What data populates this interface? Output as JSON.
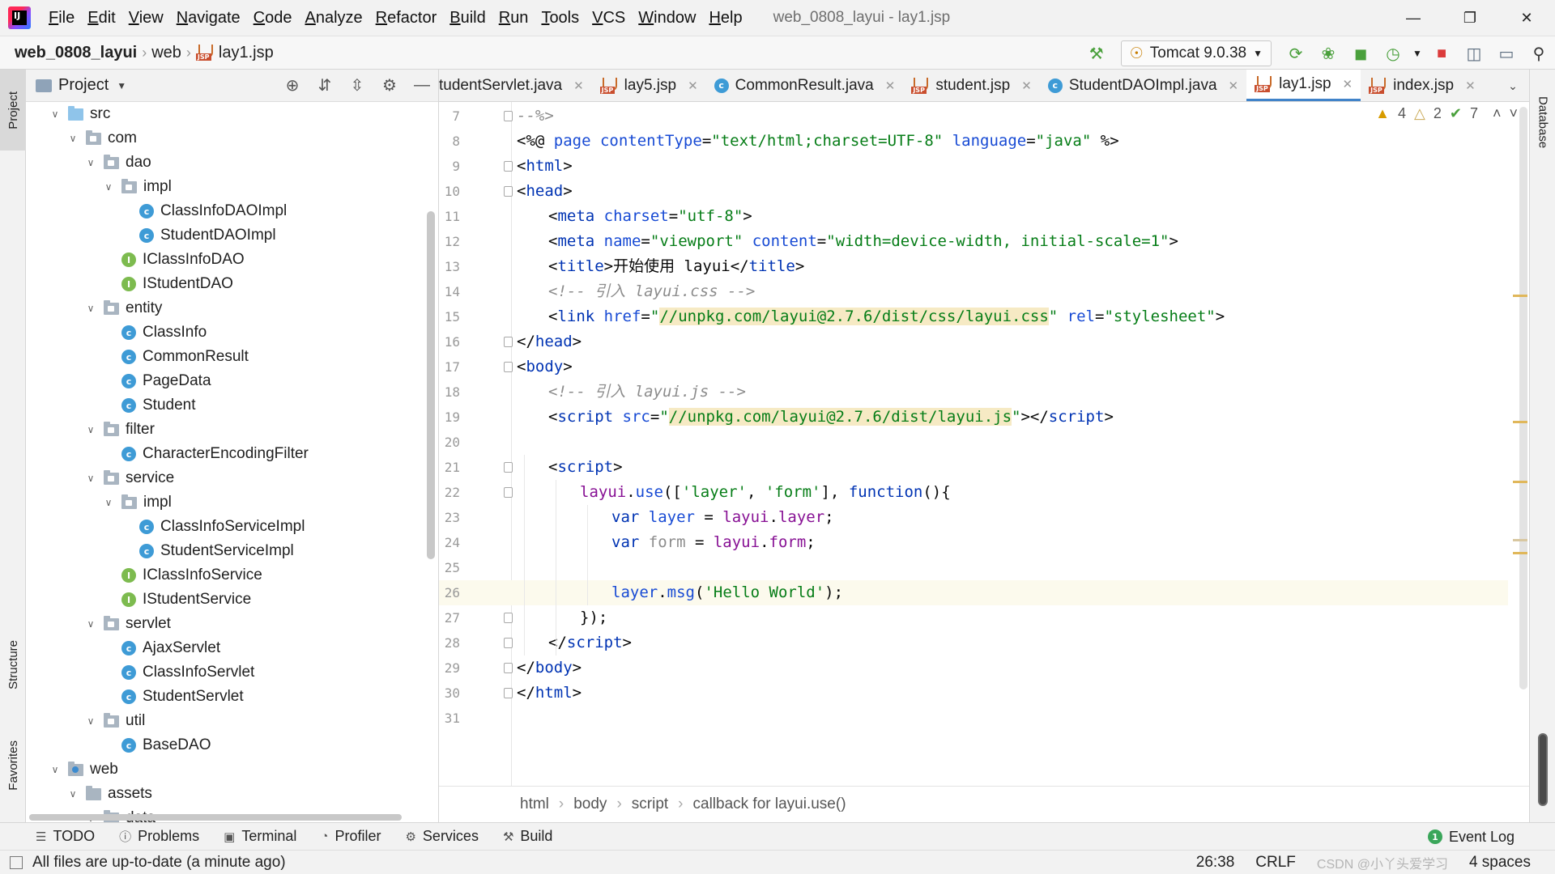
{
  "menu": {
    "items": [
      "File",
      "Edit",
      "View",
      "Navigate",
      "Code",
      "Analyze",
      "Refactor",
      "Build",
      "Run",
      "Tools",
      "VCS",
      "Window",
      "Help"
    ],
    "window_title": "web_0808_layui - lay1.jsp"
  },
  "nav": {
    "project": "web_0808_layui",
    "folder": "web",
    "file": "lay1.jsp",
    "run_config": "Tomcat 9.0.38"
  },
  "side_tabs": {
    "project": "Project",
    "structure": "Structure",
    "favorites": "Favorites",
    "database": "Database"
  },
  "project_panel": {
    "title": "Project"
  },
  "tree": [
    {
      "label": "src",
      "level": 1,
      "kind": "src-folder",
      "expanded": true
    },
    {
      "label": "com",
      "level": 2,
      "kind": "package",
      "expanded": true
    },
    {
      "label": "dao",
      "level": 3,
      "kind": "package",
      "expanded": true
    },
    {
      "label": "impl",
      "level": 4,
      "kind": "package",
      "expanded": true
    },
    {
      "label": "ClassInfoDAOImpl",
      "level": 5,
      "kind": "class"
    },
    {
      "label": "StudentDAOImpl",
      "level": 5,
      "kind": "class"
    },
    {
      "label": "IClassInfoDAO",
      "level": 4,
      "kind": "interface"
    },
    {
      "label": "IStudentDAO",
      "level": 4,
      "kind": "interface"
    },
    {
      "label": "entity",
      "level": 3,
      "kind": "package",
      "expanded": true
    },
    {
      "label": "ClassInfo",
      "level": 4,
      "kind": "class"
    },
    {
      "label": "CommonResult",
      "level": 4,
      "kind": "class"
    },
    {
      "label": "PageData",
      "level": 4,
      "kind": "class"
    },
    {
      "label": "Student",
      "level": 4,
      "kind": "class"
    },
    {
      "label": "filter",
      "level": 3,
      "kind": "package",
      "expanded": true
    },
    {
      "label": "CharacterEncodingFilter",
      "level": 4,
      "kind": "class"
    },
    {
      "label": "service",
      "level": 3,
      "kind": "package",
      "expanded": true
    },
    {
      "label": "impl",
      "level": 4,
      "kind": "package",
      "expanded": true
    },
    {
      "label": "ClassInfoServiceImpl",
      "level": 5,
      "kind": "class"
    },
    {
      "label": "StudentServiceImpl",
      "level": 5,
      "kind": "class"
    },
    {
      "label": "IClassInfoService",
      "level": 4,
      "kind": "interface"
    },
    {
      "label": "IStudentService",
      "level": 4,
      "kind": "interface"
    },
    {
      "label": "servlet",
      "level": 3,
      "kind": "package",
      "expanded": true
    },
    {
      "label": "AjaxServlet",
      "level": 4,
      "kind": "class"
    },
    {
      "label": "ClassInfoServlet",
      "level": 4,
      "kind": "class"
    },
    {
      "label": "StudentServlet",
      "level": 4,
      "kind": "class"
    },
    {
      "label": "util",
      "level": 3,
      "kind": "package",
      "expanded": true
    },
    {
      "label": "BaseDAO",
      "level": 4,
      "kind": "class"
    },
    {
      "label": "web",
      "level": 1,
      "kind": "web-folder",
      "expanded": true
    },
    {
      "label": "assets",
      "level": 2,
      "kind": "folder",
      "expanded": true
    },
    {
      "label": "data",
      "level": 3,
      "kind": "folder",
      "expanded": true
    }
  ],
  "tabs": [
    {
      "label": "tudentServlet.java",
      "icon": "none",
      "active": false
    },
    {
      "label": "lay5.jsp",
      "icon": "jsp",
      "active": false
    },
    {
      "label": "CommonResult.java",
      "icon": "class",
      "active": false
    },
    {
      "label": "student.jsp",
      "icon": "jsp",
      "active": false
    },
    {
      "label": "StudentDAOImpl.java",
      "icon": "class",
      "active": false
    },
    {
      "label": "lay1.jsp",
      "icon": "jsp",
      "active": true
    },
    {
      "label": "index.jsp",
      "icon": "jsp",
      "active": false
    }
  ],
  "inspections": {
    "warnings": "4",
    "weak_warnings": "2",
    "typos": "7"
  },
  "code_lines": [
    {
      "n": "7",
      "fold": true,
      "indent": 0,
      "parts": [
        [
          "cm",
          "--%>"
        ]
      ]
    },
    {
      "n": "8",
      "fold": false,
      "indent": 0,
      "parts": [
        [
          "pl",
          "<%@ "
        ],
        [
          "at",
          "page "
        ],
        [
          "at",
          "contentType"
        ],
        [
          "pl",
          "="
        ],
        [
          "s",
          "\"text/html;charset=UTF-8\""
        ],
        [
          "pl",
          " "
        ],
        [
          "at",
          "language"
        ],
        [
          "pl",
          "="
        ],
        [
          "s",
          "\"java\""
        ],
        [
          "pl",
          " %>"
        ]
      ]
    },
    {
      "n": "9",
      "fold": true,
      "indent": 0,
      "parts": [
        [
          "pl",
          "<"
        ],
        [
          "tn",
          "html"
        ],
        [
          "pl",
          ">"
        ]
      ]
    },
    {
      "n": "10",
      "fold": true,
      "indent": 0,
      "parts": [
        [
          "pl",
          "<"
        ],
        [
          "tn",
          "head"
        ],
        [
          "pl",
          ">"
        ]
      ]
    },
    {
      "n": "11",
      "fold": false,
      "indent": 1,
      "parts": [
        [
          "pl",
          "<"
        ],
        [
          "tn",
          "meta "
        ],
        [
          "at",
          "charset"
        ],
        [
          "pl",
          "="
        ],
        [
          "s",
          "\"utf-8\""
        ],
        [
          "pl",
          ">"
        ]
      ]
    },
    {
      "n": "12",
      "fold": false,
      "indent": 1,
      "parts": [
        [
          "pl",
          "<"
        ],
        [
          "tn",
          "meta "
        ],
        [
          "at",
          "name"
        ],
        [
          "pl",
          "="
        ],
        [
          "s",
          "\"viewport\""
        ],
        [
          "pl",
          " "
        ],
        [
          "at",
          "content"
        ],
        [
          "pl",
          "="
        ],
        [
          "s",
          "\"width=device-width, initial-scale=1\""
        ],
        [
          "pl",
          ">"
        ]
      ]
    },
    {
      "n": "13",
      "fold": false,
      "indent": 1,
      "parts": [
        [
          "pl",
          "<"
        ],
        [
          "tn",
          "title"
        ],
        [
          "pl",
          ">开始使用 layui</"
        ],
        [
          "tn",
          "title"
        ],
        [
          "pl",
          ">"
        ]
      ]
    },
    {
      "n": "14",
      "fold": false,
      "indent": 1,
      "parts": [
        [
          "cm",
          "<!-- 引入 layui.css -->"
        ]
      ]
    },
    {
      "n": "15",
      "fold": false,
      "indent": 1,
      "parts": [
        [
          "pl",
          "<"
        ],
        [
          "tn",
          "link "
        ],
        [
          "at",
          "href"
        ],
        [
          "pl",
          "="
        ],
        [
          "s",
          "\""
        ],
        [
          "shl",
          "//unpkg.com/layui@2.7.6/dist/css/layui.css"
        ],
        [
          "s",
          "\""
        ],
        [
          "pl",
          " "
        ],
        [
          "at",
          "rel"
        ],
        [
          "pl",
          "="
        ],
        [
          "s",
          "\"stylesheet\""
        ],
        [
          "pl",
          ">"
        ]
      ]
    },
    {
      "n": "16",
      "fold": true,
      "indent": 0,
      "parts": [
        [
          "pl",
          "</"
        ],
        [
          "tn",
          "head"
        ],
        [
          "pl",
          ">"
        ]
      ]
    },
    {
      "n": "17",
      "fold": true,
      "indent": 0,
      "parts": [
        [
          "pl",
          "<"
        ],
        [
          "tn",
          "body"
        ],
        [
          "pl",
          ">"
        ]
      ]
    },
    {
      "n": "18",
      "fold": false,
      "indent": 1,
      "parts": [
        [
          "cm",
          "<!-- 引入 layui.js -->"
        ]
      ]
    },
    {
      "n": "19",
      "fold": false,
      "indent": 1,
      "parts": [
        [
          "pl",
          "<"
        ],
        [
          "tn",
          "script "
        ],
        [
          "at",
          "src"
        ],
        [
          "pl",
          "="
        ],
        [
          "s",
          "\""
        ],
        [
          "shl",
          "//unpkg.com/layui@2.7.6/dist/layui.js"
        ],
        [
          "s",
          "\""
        ],
        [
          "pl",
          "></"
        ],
        [
          "tn",
          "script"
        ],
        [
          "pl",
          ">"
        ]
      ]
    },
    {
      "n": "20",
      "fold": false,
      "indent": 0,
      "parts": []
    },
    {
      "n": "21",
      "fold": true,
      "indent": 1,
      "parts": [
        [
          "pl",
          "<"
        ],
        [
          "tn",
          "script"
        ],
        [
          "pl",
          ">"
        ]
      ]
    },
    {
      "n": "22",
      "fold": true,
      "indent": 2,
      "parts": [
        [
          "vv",
          "layui"
        ],
        [
          "pl",
          "."
        ],
        [
          "at",
          "use"
        ],
        [
          "pl",
          "(["
        ],
        [
          "s",
          "'layer'"
        ],
        [
          "pl",
          ", "
        ],
        [
          "s",
          "'form'"
        ],
        [
          "pl",
          "], "
        ],
        [
          "kw",
          "function"
        ],
        [
          "pl",
          "(){"
        ]
      ]
    },
    {
      "n": "23",
      "fold": false,
      "indent": 3,
      "parts": [
        [
          "kw",
          "var "
        ],
        [
          "at",
          "layer"
        ],
        [
          "pl",
          " = "
        ],
        [
          "vv",
          "layui"
        ],
        [
          "pl",
          "."
        ],
        [
          "vv",
          "layer"
        ],
        [
          "pl",
          ";"
        ]
      ]
    },
    {
      "n": "24",
      "fold": false,
      "indent": 3,
      "parts": [
        [
          "kw",
          "var "
        ],
        [
          "cmp",
          "form"
        ],
        [
          "pl",
          " = "
        ],
        [
          "vv",
          "layui"
        ],
        [
          "pl",
          "."
        ],
        [
          "vv",
          "form"
        ],
        [
          "pl",
          ";"
        ]
      ]
    },
    {
      "n": "25",
      "fold": false,
      "indent": 0,
      "parts": []
    },
    {
      "n": "26",
      "fold": false,
      "indent": 3,
      "current": true,
      "parts": [
        [
          "at",
          "layer"
        ],
        [
          "pl",
          "."
        ],
        [
          "at",
          "msg"
        ],
        [
          "pl",
          "("
        ],
        [
          "s",
          "'Hello World'"
        ],
        [
          "pl",
          ");"
        ]
      ]
    },
    {
      "n": "27",
      "fold": true,
      "indent": 2,
      "parts": [
        [
          "pl",
          "});"
        ]
      ]
    },
    {
      "n": "28",
      "fold": true,
      "indent": 1,
      "parts": [
        [
          "pl",
          "</"
        ],
        [
          "tn",
          "script"
        ],
        [
          "pl",
          ">"
        ]
      ]
    },
    {
      "n": "29",
      "fold": true,
      "indent": 0,
      "parts": [
        [
          "pl",
          "</"
        ],
        [
          "tn",
          "body"
        ],
        [
          "pl",
          ">"
        ]
      ]
    },
    {
      "n": "30",
      "fold": true,
      "indent": 0,
      "parts": [
        [
          "pl",
          "</"
        ],
        [
          "tn",
          "html"
        ],
        [
          "pl",
          ">"
        ]
      ]
    },
    {
      "n": "31",
      "fold": false,
      "indent": 0,
      "parts": []
    }
  ],
  "breadcrumbs": [
    "html",
    "body",
    "script",
    "callback for layui.use()"
  ],
  "toolwindows": [
    {
      "label": "TODO",
      "icon": "list-icon"
    },
    {
      "label": "Problems",
      "icon": "problems-icon"
    },
    {
      "label": "Terminal",
      "icon": "terminal-icon"
    },
    {
      "label": "Profiler",
      "icon": "profiler-icon"
    },
    {
      "label": "Services",
      "icon": "services-icon"
    },
    {
      "label": "Build",
      "icon": "hammer-icon"
    }
  ],
  "event_log": "Event Log",
  "status": {
    "message": "All files are up-to-date (a minute ago)",
    "position": "26:38",
    "line_sep": "CRLF",
    "indent": "4 spaces",
    "watermark": "CSDN @小丫头爱学习"
  },
  "colors": {
    "accent": "#4083c9",
    "string": "#067d17",
    "tag": "#0033b3",
    "attribute": "#174ad4",
    "comment": "#8c8c8c",
    "variable": "#871094"
  }
}
